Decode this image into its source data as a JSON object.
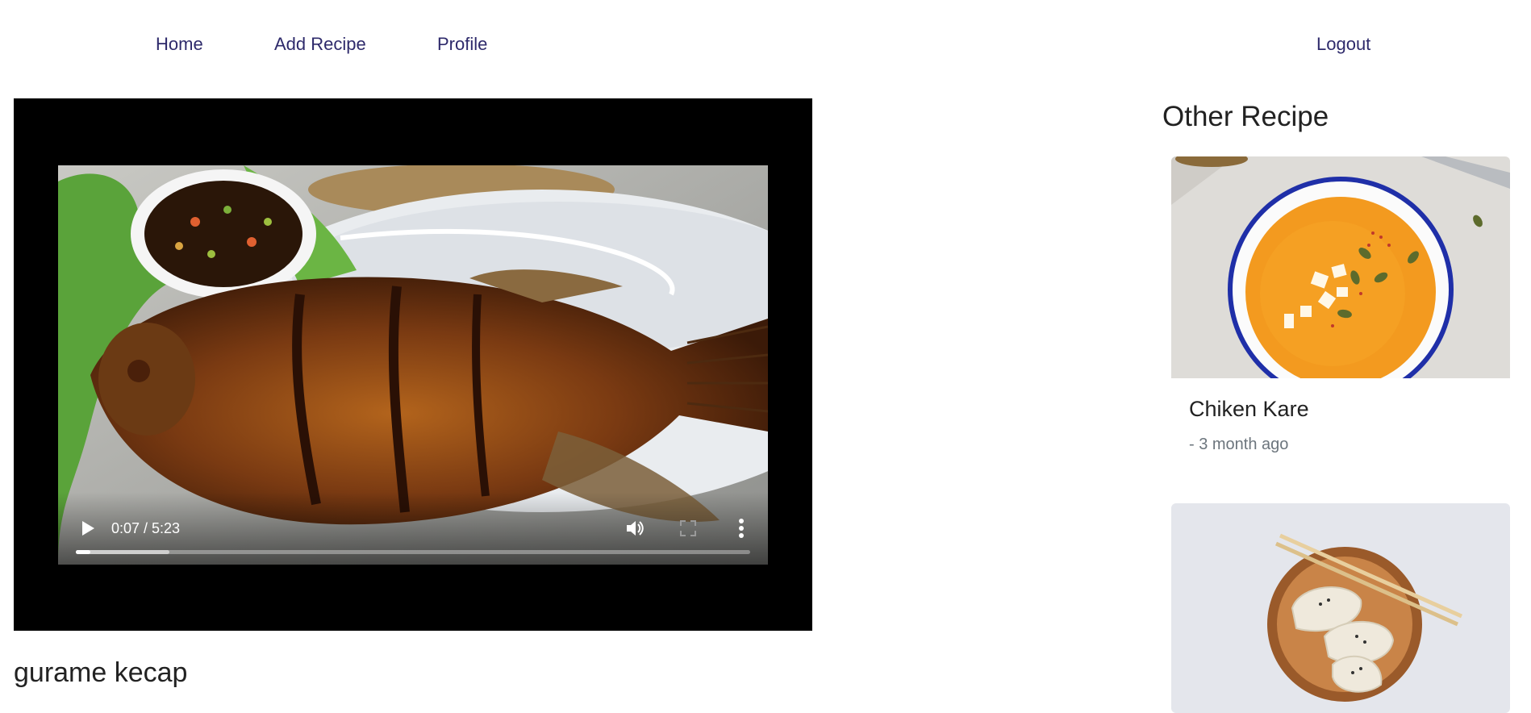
{
  "nav": {
    "home": "Home",
    "add_recipe": "Add Recipe",
    "profile": "Profile",
    "logout": "Logout"
  },
  "video": {
    "time_display": "0:07 / 5:23",
    "progress_fraction": 0.022,
    "buffered_fraction": 0.139,
    "icons": [
      "play-icon",
      "volume-icon",
      "fullscreen-icon",
      "more-options-icon"
    ]
  },
  "recipe": {
    "title": "gurame kecap"
  },
  "sidebar": {
    "title": "Other Recipe",
    "cards": [
      {
        "name": "Chiken Kare",
        "time": "- 3 month ago"
      },
      {
        "name": "",
        "time": ""
      }
    ]
  },
  "colors": {
    "nav_link": "#2e2a6b",
    "muted_text": "#6c757d",
    "player_bg": "#000000"
  }
}
